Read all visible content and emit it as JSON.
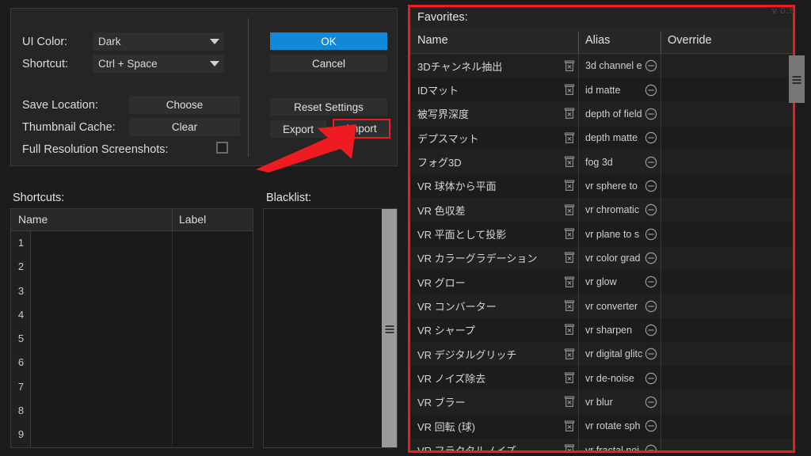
{
  "settings": {
    "ui_color_label": "UI Color:",
    "ui_color_value": "Dark",
    "shortcut_label": "Shortcut:",
    "shortcut_value": "Ctrl + Space",
    "save_location_label": "Save Location:",
    "save_location_button": "Choose",
    "thumbnail_cache_label": "Thumbnail Cache:",
    "thumbnail_cache_button": "Clear",
    "full_res_label": "Full Resolution Screenshots:",
    "full_res_checked": false
  },
  "actions": {
    "ok": "OK",
    "cancel": "Cancel",
    "reset": "Reset Settings",
    "export": "Export",
    "import": "Import"
  },
  "shortcuts": {
    "title": "Shortcuts:",
    "columns": [
      "Name",
      "Label"
    ],
    "rows": [
      {
        "num": "1",
        "name": "",
        "label": ""
      },
      {
        "num": "2",
        "name": "",
        "label": ""
      },
      {
        "num": "3",
        "name": "",
        "label": ""
      },
      {
        "num": "4",
        "name": "",
        "label": ""
      },
      {
        "num": "5",
        "name": "",
        "label": ""
      },
      {
        "num": "6",
        "name": "",
        "label": ""
      },
      {
        "num": "7",
        "name": "",
        "label": ""
      },
      {
        "num": "8",
        "name": "",
        "label": ""
      },
      {
        "num": "9",
        "name": "",
        "label": ""
      }
    ]
  },
  "blacklist": {
    "title": "Blacklist:",
    "items": []
  },
  "favorites": {
    "title": "Favorites:",
    "columns": [
      "Name",
      "Alias",
      "Override"
    ],
    "rows": [
      {
        "name": "3Dチャンネル抽出",
        "alias": "3d channel e",
        "override": ""
      },
      {
        "name": "IDマット",
        "alias": "id matte",
        "override": ""
      },
      {
        "name": "被写界深度",
        "alias": "depth of field",
        "override": ""
      },
      {
        "name": "デプスマット",
        "alias": "depth matte",
        "override": ""
      },
      {
        "name": "フォグ3D",
        "alias": "fog 3d",
        "override": ""
      },
      {
        "name": "VR 球体から平面",
        "alias": "vr sphere to",
        "override": ""
      },
      {
        "name": "VR 色収差",
        "alias": "vr chromatic",
        "override": ""
      },
      {
        "name": "VR 平面として投影",
        "alias": "vr plane to s",
        "override": ""
      },
      {
        "name": "VR カラーグラデーション",
        "alias": "vr color grad",
        "override": ""
      },
      {
        "name": "VR グロー",
        "alias": "vr glow",
        "override": ""
      },
      {
        "name": "VR コンバーター",
        "alias": "vr converter",
        "override": ""
      },
      {
        "name": "VR シャープ",
        "alias": "vr sharpen",
        "override": ""
      },
      {
        "name": "VR デジタルグリッチ",
        "alias": "vr digital glitc",
        "override": ""
      },
      {
        "name": "VR ノイズ除去",
        "alias": "vr de-noise",
        "override": ""
      },
      {
        "name": "VR ブラー",
        "alias": "vr blur",
        "override": ""
      },
      {
        "name": "VR 回転 (球)",
        "alias": "vr rotate sph",
        "override": ""
      },
      {
        "name": "VR フラクタルノイズ",
        "alias": "vr fractal noi",
        "override": ""
      }
    ]
  },
  "version": "v 0.5",
  "colors": {
    "accent_blue": "#1289d8",
    "annotation_red": "#ee1c21",
    "panel_bg": "#252525",
    "list_bg": "#1e1e1e",
    "text": "#dcdcdc"
  }
}
